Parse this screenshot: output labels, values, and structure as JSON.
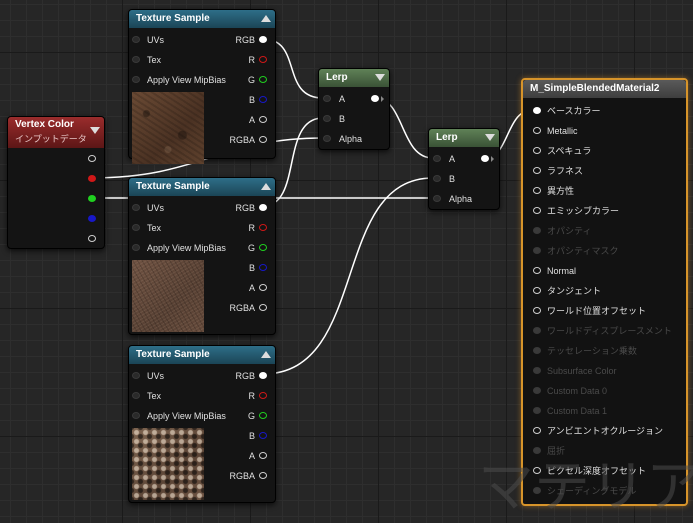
{
  "colors": {
    "wire": "#ffffff",
    "pin_r": "#d01818",
    "pin_g": "#20d020",
    "pin_b": "#1818c8",
    "material_border": "#d7942a"
  },
  "texture_nodes": [
    {
      "title": "Texture Sample",
      "inputs": [
        "UVs",
        "Tex",
        "Apply View MipBias"
      ],
      "outputs": [
        "RGB",
        "R",
        "G",
        "B",
        "A",
        "RGBA"
      ]
    },
    {
      "title": "Texture Sample",
      "inputs": [
        "UVs",
        "Tex",
        "Apply View MipBias"
      ],
      "outputs": [
        "RGB",
        "R",
        "G",
        "B",
        "A",
        "RGBA"
      ]
    },
    {
      "title": "Texture Sample",
      "inputs": [
        "UVs",
        "Tex",
        "Apply View MipBias"
      ],
      "outputs": [
        "RGB",
        "R",
        "G",
        "B",
        "A",
        "RGBA"
      ]
    }
  ],
  "vertex_color": {
    "title": "Vertex Color",
    "subtitle": "インプットデータ"
  },
  "lerp_nodes": [
    {
      "title": "Lerp",
      "inputs": [
        "A",
        "B",
        "Alpha"
      ]
    },
    {
      "title": "Lerp",
      "inputs": [
        "A",
        "B",
        "Alpha"
      ]
    }
  ],
  "material": {
    "title": "M_SimpleBlendedMaterial2",
    "pins": [
      {
        "label": "ベースカラー",
        "enabled": true
      },
      {
        "label": "Metallic",
        "enabled": true
      },
      {
        "label": "スペキュラ",
        "enabled": true
      },
      {
        "label": "ラフネス",
        "enabled": true
      },
      {
        "label": "異方性",
        "enabled": true
      },
      {
        "label": "エミッシブカラー",
        "enabled": true
      },
      {
        "label": "オパシティ",
        "enabled": false
      },
      {
        "label": "オパシティマスク",
        "enabled": false
      },
      {
        "label": "Normal",
        "enabled": true
      },
      {
        "label": "タンジェント",
        "enabled": true
      },
      {
        "label": "ワールド位置オフセット",
        "enabled": true
      },
      {
        "label": "ワールドディスプレースメント",
        "enabled": false
      },
      {
        "label": "テッセレーション乗数",
        "enabled": false
      },
      {
        "label": "Subsurface Color",
        "enabled": false
      },
      {
        "label": "Custom Data 0",
        "enabled": false
      },
      {
        "label": "Custom Data 1",
        "enabled": false
      },
      {
        "label": "アンビエントオクルージョン",
        "enabled": true
      },
      {
        "label": "屈折",
        "enabled": false
      },
      {
        "label": "ピクセル深度オフセット",
        "enabled": true
      },
      {
        "label": "シェーディングモデル",
        "enabled": false
      }
    ]
  },
  "watermark": "マテリア"
}
